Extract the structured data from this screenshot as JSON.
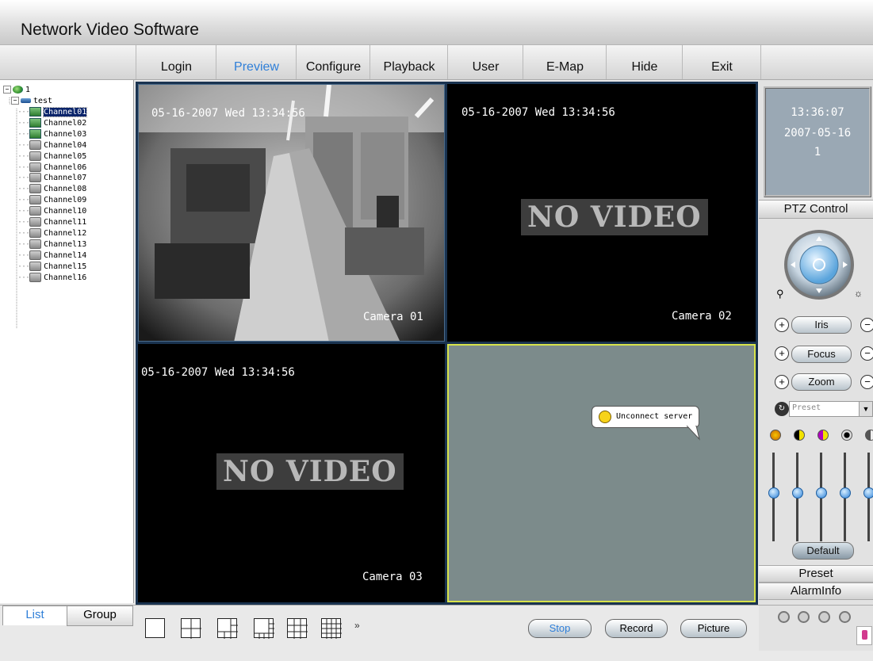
{
  "app": {
    "title": "Network Video Software"
  },
  "menu": [
    {
      "label": "Login",
      "active": false
    },
    {
      "label": "Preview",
      "active": true
    },
    {
      "label": "Configure",
      "active": false
    },
    {
      "label": "Playback",
      "active": false
    },
    {
      "label": "User",
      "active": false
    },
    {
      "label": "E-Map",
      "active": false
    },
    {
      "label": "Hide",
      "active": false
    },
    {
      "label": "Exit",
      "active": false
    }
  ],
  "tree": {
    "root": "1",
    "device": "test",
    "channels": [
      "Channel01",
      "Channel02",
      "Channel03",
      "Channel04",
      "Channel05",
      "Channel06",
      "Channel07",
      "Channel08",
      "Channel09",
      "Channel10",
      "Channel11",
      "Channel12",
      "Channel13",
      "Channel14",
      "Channel15",
      "Channel16"
    ],
    "online_count": 3,
    "selected": "Channel01"
  },
  "tabs": {
    "list": "List",
    "group": "Group"
  },
  "video": {
    "panes": [
      {
        "timestamp": "05-16-2007 Wed 13:34:56",
        "camera": "Camera 01",
        "status": "live"
      },
      {
        "timestamp": "05-16-2007 Wed 13:34:56",
        "camera": "Camera 02",
        "status": "NO VIDEO"
      },
      {
        "timestamp": "05-16-2007 Wed 13:34:56",
        "camera": "Camera 03",
        "status": "NO VIDEO"
      },
      {
        "timestamp": "",
        "camera": "",
        "status": "Unconnect server"
      }
    ]
  },
  "clock": {
    "time": "13:36:07",
    "date": "2007-05-16",
    "channel": "1"
  },
  "ptz": {
    "header": "PTZ Control",
    "iris": "Iris",
    "focus": "Focus",
    "zoom": "Zoom",
    "preset_placeholder": "Preset",
    "default_label": "Default",
    "preset_header": "Preset",
    "alarm_header": "AlarmInfo",
    "sliders": [
      0.55,
      0.55,
      0.55,
      0.55,
      0.55
    ]
  },
  "toolbar": {
    "stop": "Stop",
    "record": "Record",
    "picture": "Picture",
    "more": "»"
  },
  "colors": {
    "accent": "#2f7fd8",
    "selected_pane": "#d8e34a",
    "grid_bg": "#1a3350"
  }
}
